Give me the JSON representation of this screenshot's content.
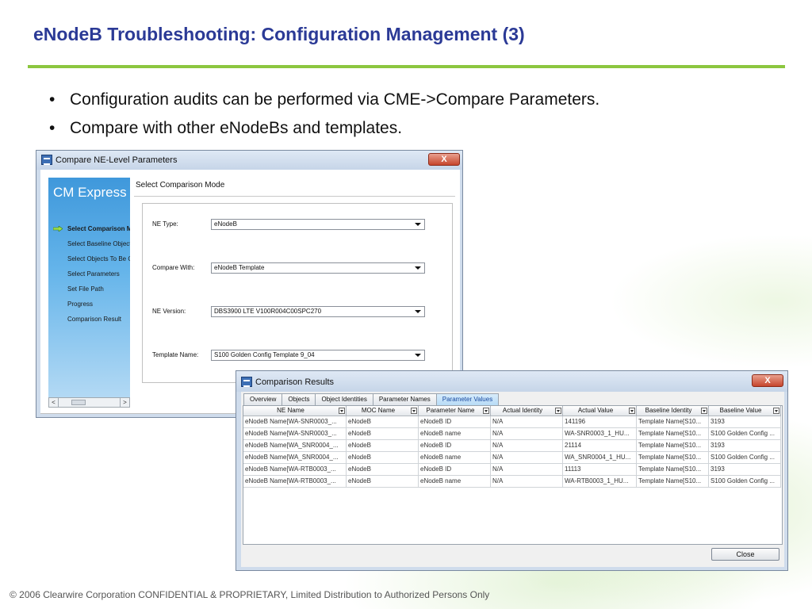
{
  "slide": {
    "title": "eNodeB Troubleshooting: Configuration Management (3)",
    "bullets": [
      "Configuration audits can be performed via CME->Compare Parameters.",
      "Compare with other eNodeBs and templates."
    ],
    "footer": "© 2006 Clearwire Corporation CONFIDENTIAL & PROPRIETARY, Limited Distribution to Authorized Persons Only"
  },
  "compare_window": {
    "title": "Compare NE-Level Parameters",
    "close_glyph": "X",
    "brand": "CM Express",
    "steps": [
      "Select Comparison Mode",
      "Select Baseline Objects",
      "Select Objects To Be Compared",
      "Select Parameters",
      "Set File Path",
      "Progress",
      "Comparison Result"
    ],
    "active_step_index": 0,
    "scroll_left": "<",
    "scroll_right": ">",
    "section_header": "Select Comparison Mode",
    "fields": {
      "ne_type": {
        "label": "NE Type:",
        "value": "eNodeB"
      },
      "compare_with": {
        "label": "Compare With:",
        "value": "eNodeB Template"
      },
      "ne_version": {
        "label": "NE Version:",
        "value": "DBS3900 LTE V100R004C00SPC270"
      },
      "template_name": {
        "label": "Template Name:",
        "value": "S100 Golden Config Template 9_04"
      }
    }
  },
  "results_window": {
    "title": "Comparison Results",
    "close_glyph": "X",
    "tabs": [
      "Overview",
      "Objects",
      "Object Identities",
      "Parameter Names",
      "Parameter Values"
    ],
    "active_tab_index": 4,
    "columns": [
      "NE Name",
      "MOC Name",
      "Parameter Name",
      "Actual Identity",
      "Actual Value",
      "Baseline Identity",
      "Baseline Value"
    ],
    "rows": [
      [
        "eNodeB Name[WA-SNR0003_...",
        "eNodeB",
        "eNodeB ID",
        "N/A",
        "141196",
        "Template Name[S10...",
        "3193"
      ],
      [
        "eNodeB Name[WA-SNR0003_...",
        "eNodeB",
        "eNodeB name",
        "N/A",
        "WA-SNR0003_1_HU...",
        "Template Name[S10...",
        "S100 Golden Config ..."
      ],
      [
        "eNodeB Name[WA_SNR0004_...",
        "eNodeB",
        "eNodeB ID",
        "N/A",
        "21114",
        "Template Name[S10...",
        "3193"
      ],
      [
        "eNodeB Name[WA_SNR0004_...",
        "eNodeB",
        "eNodeB name",
        "N/A",
        "WA_SNR0004_1_HU...",
        "Template Name[S10...",
        "S100 Golden Config ..."
      ],
      [
        "eNodeB Name[WA-RTB0003_...",
        "eNodeB",
        "eNodeB ID",
        "N/A",
        "11113",
        "Template Name[S10...",
        "3193"
      ],
      [
        "eNodeB Name[WA-RTB0003_...",
        "eNodeB",
        "eNodeB name",
        "N/A",
        "WA-RTB0003_1_HU...",
        "Template Name[S10...",
        "S100 Golden Config ..."
      ]
    ],
    "close_label": "Close"
  },
  "colors": {
    "title_blue": "#2b3a96",
    "rule_green": "#8cc63f",
    "close_red": "#c6452c"
  }
}
